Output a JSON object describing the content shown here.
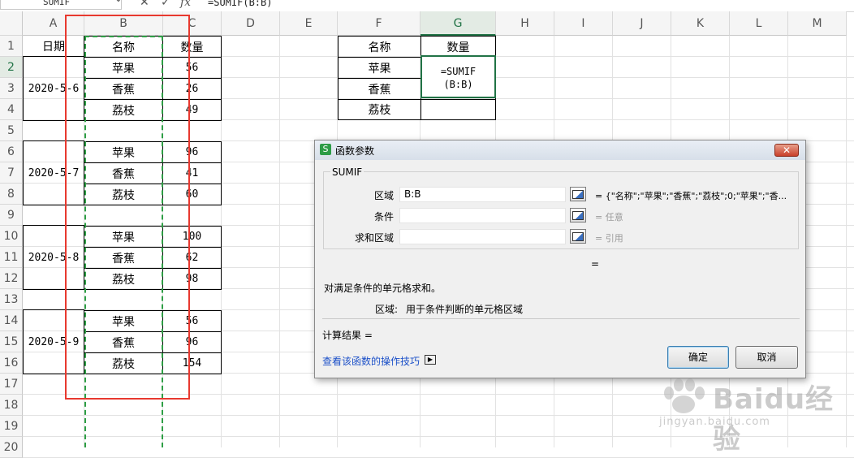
{
  "formula_bar": {
    "name_box": "SUMIF",
    "cancel_icon": "✕",
    "confirm_icon": "✓",
    "fx_label": "fx",
    "formula": "=SUMIF(B:B)"
  },
  "columns": [
    "A",
    "B",
    "C",
    "D",
    "E",
    "F",
    "G",
    "H",
    "I",
    "J",
    "K",
    "L",
    "M"
  ],
  "rows": [
    "1",
    "2",
    "3",
    "4",
    "5",
    "6",
    "7",
    "8",
    "9",
    "10",
    "11",
    "12",
    "13",
    "14",
    "15",
    "16",
    "17",
    "18",
    "19",
    "20"
  ],
  "table1": {
    "headers": {
      "date": "日期",
      "name": "名称",
      "qty": "数量"
    },
    "groups": [
      {
        "date": "2020-5-6",
        "items": [
          {
            "name": "苹果",
            "qty": "56"
          },
          {
            "name": "香蕉",
            "qty": "26"
          },
          {
            "name": "荔枝",
            "qty": "49"
          }
        ]
      },
      {
        "date": "2020-5-7",
        "items": [
          {
            "name": "苹果",
            "qty": "96"
          },
          {
            "name": "香蕉",
            "qty": "41"
          },
          {
            "name": "荔枝",
            "qty": "60"
          }
        ]
      },
      {
        "date": "2020-5-8",
        "items": [
          {
            "name": "苹果",
            "qty": "100"
          },
          {
            "name": "香蕉",
            "qty": "62"
          },
          {
            "name": "荔枝",
            "qty": "98"
          }
        ]
      },
      {
        "date": "2020-5-9",
        "items": [
          {
            "name": "苹果",
            "qty": "56"
          },
          {
            "name": "香蕉",
            "qty": "96"
          },
          {
            "name": "荔枝",
            "qty": "154"
          }
        ]
      }
    ]
  },
  "table2": {
    "headers": {
      "name": "名称",
      "qty": "数量"
    },
    "rows": [
      {
        "name": "苹果"
      },
      {
        "name": "香蕉"
      },
      {
        "name": "荔枝"
      }
    ],
    "editing_cell": {
      "line1": "=SUMIF",
      "line2": "(B:B)"
    }
  },
  "dialog": {
    "title": "函数参数",
    "logo": "S",
    "close_icon": "✕",
    "function_name": "SUMIF",
    "params": [
      {
        "label": "区域",
        "value": "B:B",
        "result": "= {\"名称\";\"苹果\";\"香蕉\";\"荔枝\";0;\"苹果\";\"香..."
      },
      {
        "label": "条件",
        "value": "",
        "result": "= 任意"
      },
      {
        "label": "求和区域",
        "value": "",
        "result": "= 引用"
      }
    ],
    "result_eq": "=",
    "description": "对满足条件的单元格求和。",
    "param_help_label": "区域:",
    "param_help_text": "用于条件判断的单元格区域",
    "calc_result_label": "计算结果 =",
    "help_link": "查看该函数的操作技巧",
    "ok_label": "确定",
    "cancel_label": "取消"
  },
  "watermark": {
    "brand": "Baidu经验",
    "url": "jingyan.baidu.com"
  },
  "colors": {
    "selection_green": "#217346",
    "annotation_red": "#e8392f",
    "dashed_green": "#2e9f45"
  }
}
